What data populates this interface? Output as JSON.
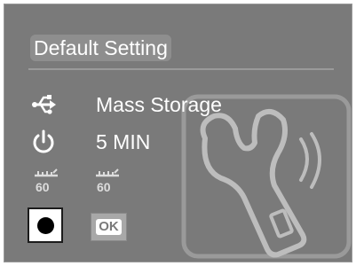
{
  "title": "Default Setting",
  "usb_mode": {
    "icon": "usb-icon",
    "label": "Mass Storage"
  },
  "auto_off": {
    "icon": "power-icon",
    "label": "5 MIN"
  },
  "frequency_icons": [
    {
      "icon": "light-frequency-icon",
      "label": "60"
    },
    {
      "icon": "light-frequency-icon",
      "label": "60"
    }
  ],
  "buttons": {
    "record": {
      "icon": "record-icon"
    },
    "ok": {
      "label": "OK"
    }
  },
  "decoration": {
    "icon": "wrench-icon"
  },
  "colors": {
    "screen_bg": "#7a7a7a",
    "text": "#ffffff",
    "title_bg": "#8e8e8e"
  }
}
